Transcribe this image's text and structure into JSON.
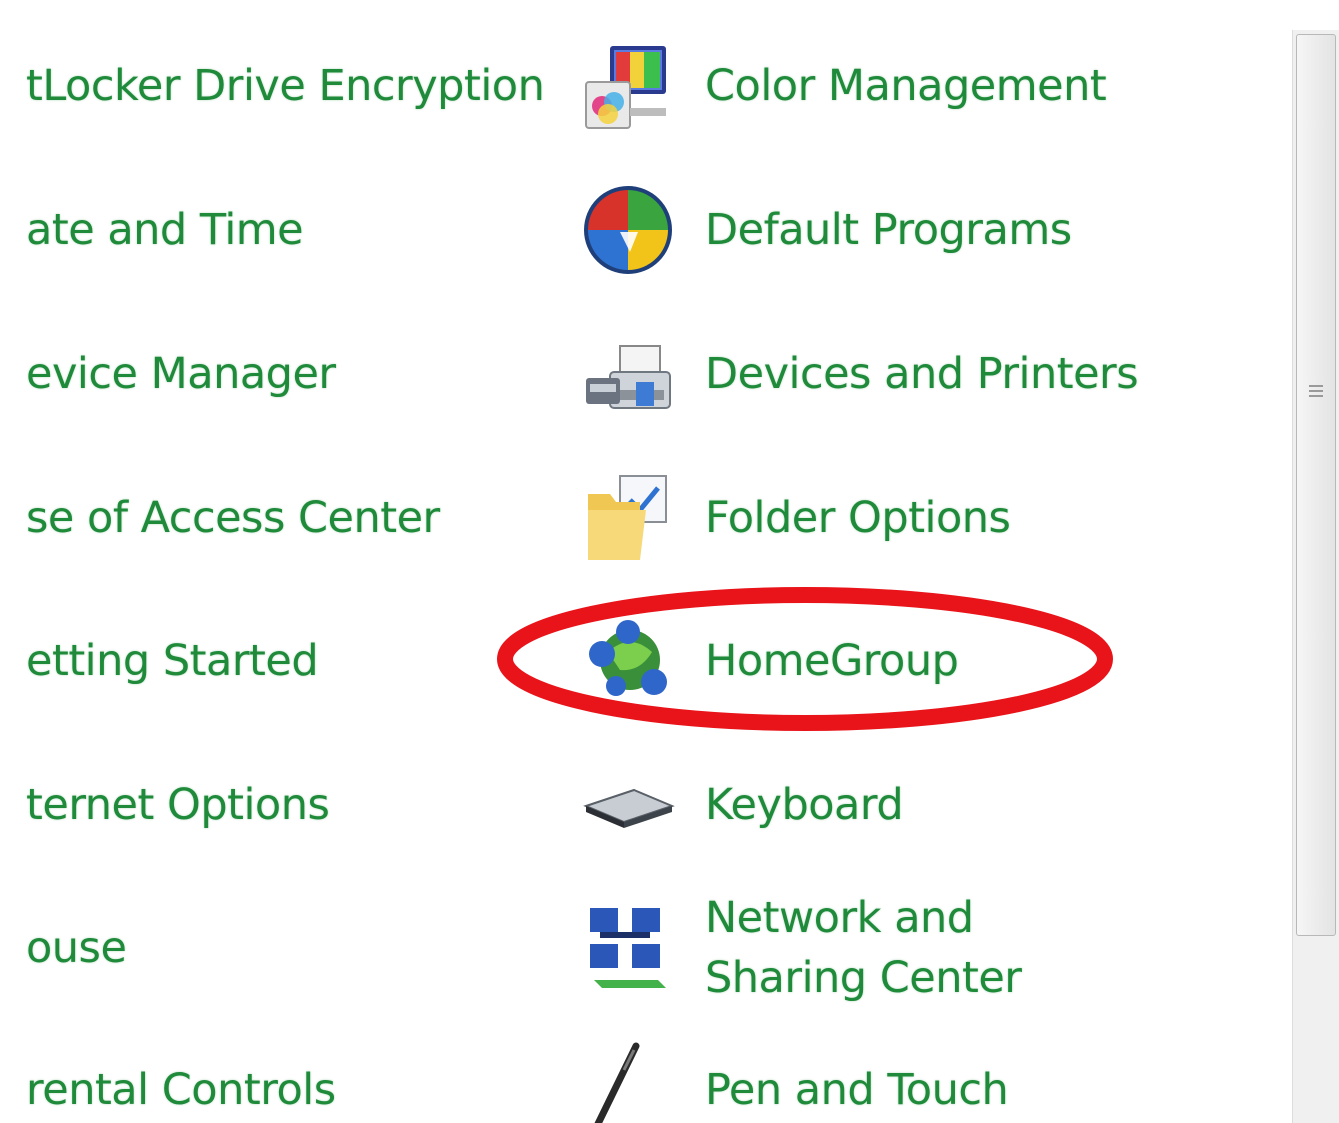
{
  "left_column": {
    "items": [
      {
        "label": "tLocker Drive Encryption"
      },
      {
        "label": "ate and Time"
      },
      {
        "label": "evice Manager"
      },
      {
        "label": "se of Access Center"
      },
      {
        "label": "etting Started"
      },
      {
        "label": "ternet Options"
      },
      {
        "label": "ouse"
      },
      {
        "label": "rental Controls"
      }
    ]
  },
  "right_column": {
    "items": [
      {
        "label": "Color Management",
        "icon": "color-management-icon"
      },
      {
        "label": "Default Programs",
        "icon": "default-programs-icon"
      },
      {
        "label": "Devices and Printers",
        "icon": "devices-printers-icon"
      },
      {
        "label": "Folder Options",
        "icon": "folder-options-icon"
      },
      {
        "label": "HomeGroup",
        "icon": "homegroup-icon",
        "highlighted": true
      },
      {
        "label": "Keyboard",
        "icon": "keyboard-icon"
      },
      {
        "label": "Network and Sharing Center",
        "icon": "network-sharing-icon"
      },
      {
        "label": "Pen and Touch",
        "icon": "pen-touch-icon"
      }
    ]
  },
  "colors": {
    "link": "#1e8a3a",
    "highlight": "#e8141a",
    "background": "#ffffff"
  }
}
